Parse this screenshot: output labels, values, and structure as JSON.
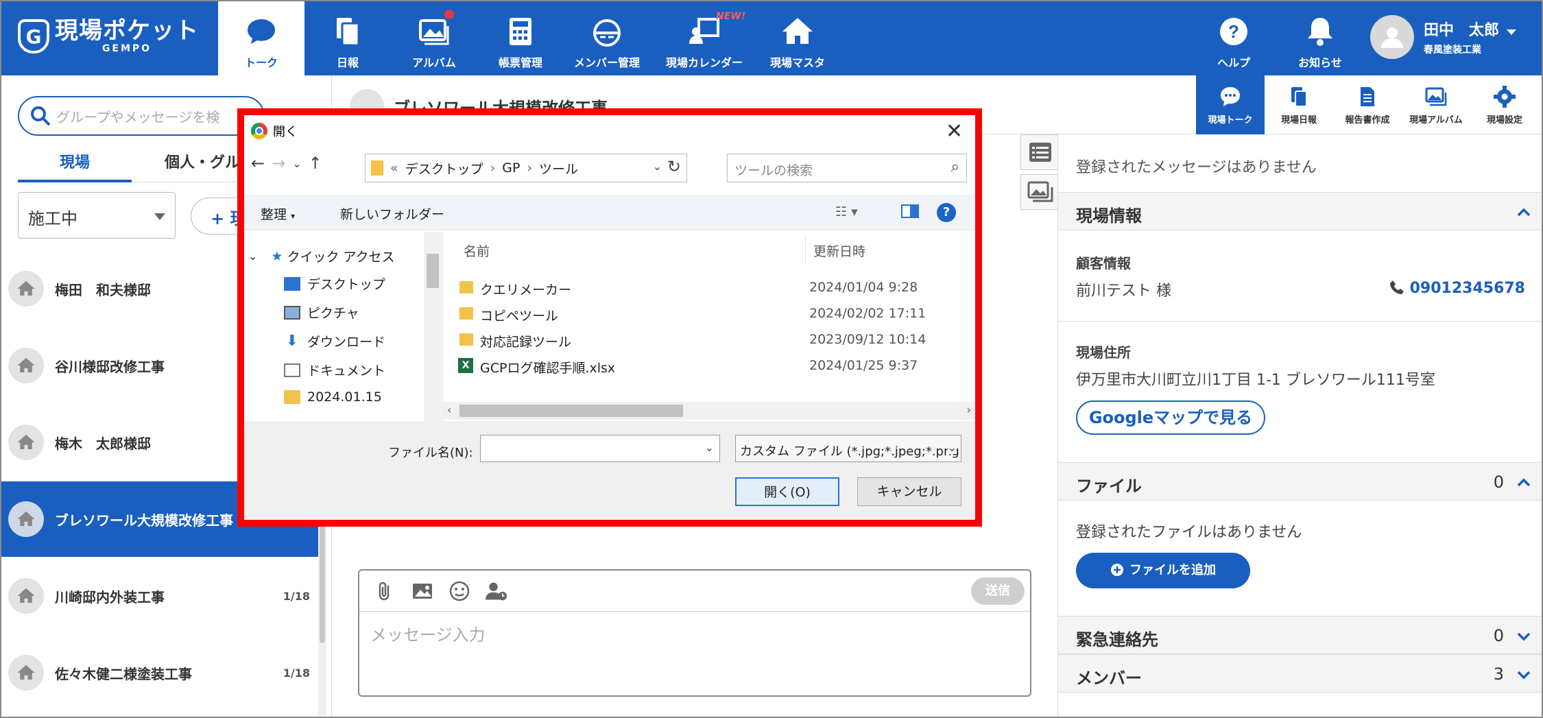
{
  "app": {
    "logo_text": "現場ポケット",
    "logo_sub": "GEMPO",
    "logo_mark": "G"
  },
  "topnav": {
    "items": [
      {
        "label": "トーク",
        "icon": "chat-bubble-icon",
        "active": true
      },
      {
        "label": "日報",
        "icon": "documents-icon"
      },
      {
        "label": "アルバム",
        "icon": "album-icon"
      },
      {
        "label": "帳票管理",
        "icon": "calculator-icon"
      },
      {
        "label": "メンバー管理",
        "icon": "helmet-icon"
      },
      {
        "label": "現場カレンダー",
        "icon": "calendar-person-icon"
      },
      {
        "label": "現場マスタ",
        "icon": "house-icon"
      },
      {
        "label": "ヘルプ",
        "icon": "help-icon"
      },
      {
        "label": "お知らせ",
        "icon": "bell-icon"
      }
    ],
    "new_tag": "NEW!",
    "user_name": "田中　太郎",
    "user_company": "春風塗装工業"
  },
  "left": {
    "search_placeholder": "グループやメッセージを検",
    "tab_site": "現場",
    "tab_personal": "個人・グル",
    "status_select": "施工中",
    "add_label": "+ 現",
    "sites": [
      {
        "name": "梅田　和夫様邸",
        "date": ""
      },
      {
        "name": "谷川様邸改修工事",
        "date": ""
      },
      {
        "name": "梅木　太郎様邸",
        "date": ""
      },
      {
        "name": "ブレソワール大規模改修工事",
        "date": "",
        "active": true
      },
      {
        "name": "川崎邸内外装工事",
        "date": "1/18"
      },
      {
        "name": "佐々木健二様塗装工事",
        "date": "1/18"
      }
    ]
  },
  "middle": {
    "title": "ブレソワール大規模改修工事",
    "compose_placeholder": "メッセージ入力",
    "send_label": "送信"
  },
  "rightnav": {
    "items": [
      {
        "label": "現場トーク",
        "icon": "chat-icon",
        "active": true
      },
      {
        "label": "現場日報",
        "icon": "report-icon"
      },
      {
        "label": "報告書作成",
        "icon": "document-icon"
      },
      {
        "label": "現場アルバム",
        "icon": "album-icon"
      },
      {
        "label": "現場設定",
        "icon": "gear-icon"
      }
    ]
  },
  "right": {
    "no_messages": "登録されたメッセージはありません",
    "site_info_title": "現場情報",
    "customer_label": "顧客情報",
    "customer_name": "前川テスト 様",
    "phone": "09012345678",
    "address_label": "現場住所",
    "address": "伊万里市大川町立川1丁目 1-1 ブレソワール111号室",
    "gmap_button": "Googleマップで見る",
    "file_title": "ファイル",
    "file_count": "0",
    "no_files": "登録されたファイルはありません",
    "add_file_button": "ファイルを追加",
    "emergency_title": "緊急連絡先",
    "emergency_count": "0",
    "member_title": "メンバー",
    "member_count": "3"
  },
  "dialog": {
    "title": "開く",
    "address_parts": [
      "デスクトップ",
      "GP",
      "ツール"
    ],
    "address_prefix": "«",
    "search_placeholder": "ツールの検索",
    "organize": "整理",
    "new_folder": "新しいフォルダー",
    "nav": [
      {
        "label": "クイック アクセス",
        "icon": "star-icon"
      },
      {
        "label": "デスクトップ",
        "icon": "desktop-icon",
        "pinned": true
      },
      {
        "label": "ピクチャ",
        "icon": "pictures-icon",
        "pinned": true
      },
      {
        "label": "ダウンロード",
        "icon": "download-icon",
        "pinned": true
      },
      {
        "label": "ドキュメント",
        "icon": "documents-icon",
        "pinned": true
      },
      {
        "label": "2024.01.15",
        "icon": "folder-icon",
        "pinned": true
      }
    ],
    "col_name": "名前",
    "col_date": "更新日時",
    "files": [
      {
        "name": "クエリメーカー",
        "date": "2024/01/04 9:28",
        "type": "folder"
      },
      {
        "name": "コピペツール",
        "date": "2024/02/02 17:11",
        "type": "folder"
      },
      {
        "name": "対応記録ツール",
        "date": "2023/09/12 10:14",
        "type": "folder"
      },
      {
        "name": "GCPログ確認手順.xlsx",
        "date": "2024/01/25 9:37",
        "type": "excel"
      }
    ],
    "filename_label": "ファイル名(N):",
    "filename_value": "",
    "filetype": "カスタム ファイル (*.jpg;*.jpeg;*.png",
    "open_button": "開く(O)",
    "cancel_button": "キャンセル"
  },
  "colors": {
    "brand": "#1a5fbf",
    "highlight": "#ff0000"
  }
}
